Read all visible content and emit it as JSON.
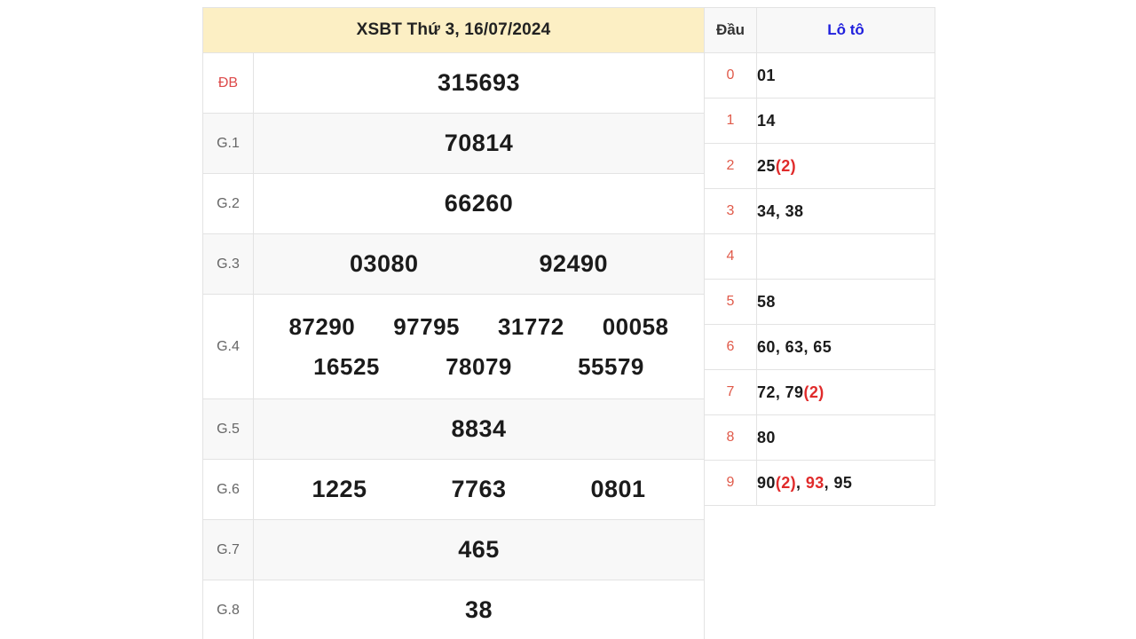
{
  "colors": {
    "header_bg": "#fcefc4",
    "special_red": "#e02b2b",
    "label_red": "#dd4b4b",
    "loto_header_blue": "#2020dd",
    "alt_row_bg": "#f8f8f8",
    "border": "#e3e3e3"
  },
  "prize_table": {
    "header": "XSBT Thứ 3, 16/07/2024",
    "rows": [
      {
        "label": "ĐB",
        "numbers": [
          "315693"
        ]
      },
      {
        "label": "G.1",
        "numbers": [
          "70814"
        ]
      },
      {
        "label": "G.2",
        "numbers": [
          "66260"
        ]
      },
      {
        "label": "G.3",
        "numbers": [
          "03080",
          "92490"
        ]
      },
      {
        "label": "G.4",
        "numbers": [
          "87290",
          "97795",
          "31772",
          "00058",
          "16525",
          "78079",
          "55579"
        ]
      },
      {
        "label": "G.5",
        "numbers": [
          "8834"
        ]
      },
      {
        "label": "G.6",
        "numbers": [
          "1225",
          "7763",
          "0801"
        ]
      },
      {
        "label": "G.7",
        "numbers": [
          "465"
        ]
      },
      {
        "label": "G.8",
        "numbers": [
          "38"
        ]
      }
    ]
  },
  "loto_table": {
    "header": {
      "dau": "Đầu",
      "loto": "Lô tô"
    },
    "rows": [
      {
        "dau": "0",
        "items": [
          {
            "num": "01",
            "count": "",
            "hot": false
          }
        ]
      },
      {
        "dau": "1",
        "items": [
          {
            "num": "14",
            "count": "",
            "hot": false
          }
        ]
      },
      {
        "dau": "2",
        "items": [
          {
            "num": "25",
            "count": "(2)",
            "hot": false
          }
        ]
      },
      {
        "dau": "3",
        "items": [
          {
            "num": "34",
            "count": "",
            "hot": false
          },
          {
            "num": "38",
            "count": "",
            "hot": false
          }
        ]
      },
      {
        "dau": "4",
        "items": []
      },
      {
        "dau": "5",
        "items": [
          {
            "num": "58",
            "count": "",
            "hot": false
          }
        ]
      },
      {
        "dau": "6",
        "items": [
          {
            "num": "60",
            "count": "",
            "hot": false
          },
          {
            "num": "63",
            "count": "",
            "hot": false
          },
          {
            "num": "65",
            "count": "",
            "hot": false
          }
        ]
      },
      {
        "dau": "7",
        "items": [
          {
            "num": "72",
            "count": "",
            "hot": false
          },
          {
            "num": "79",
            "count": "(2)",
            "hot": false
          }
        ]
      },
      {
        "dau": "8",
        "items": [
          {
            "num": "80",
            "count": "",
            "hot": false
          }
        ]
      },
      {
        "dau": "9",
        "items": [
          {
            "num": "90",
            "count": "(2)",
            "hot": false
          },
          {
            "num": "93",
            "count": "",
            "hot": true
          },
          {
            "num": "95",
            "count": "",
            "hot": false
          }
        ]
      }
    ]
  }
}
